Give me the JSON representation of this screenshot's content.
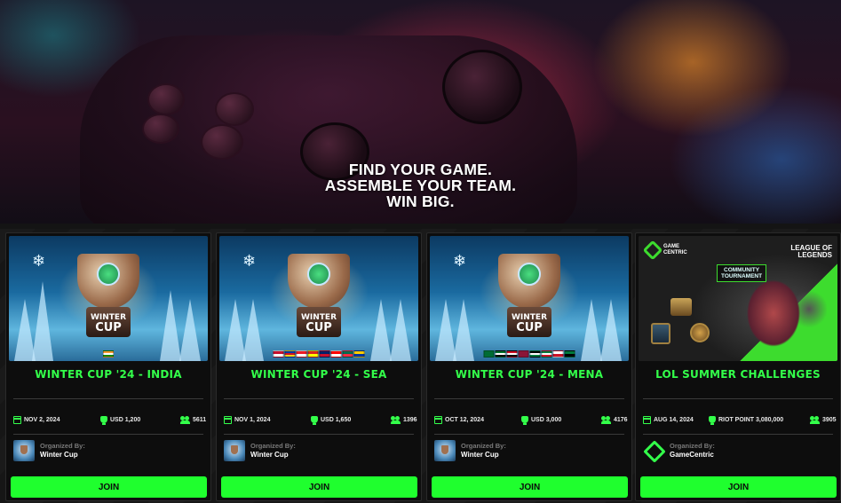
{
  "hero": {
    "line1": "FIND YOUR GAME.",
    "line2": "ASSEMBLE YOUR TEAM.",
    "line3": "WIN BIG."
  },
  "cards": [
    {
      "title": "WINTER CUP '24 - INDIA",
      "date": "NOV 2, 2024",
      "prize": "USD 1,200",
      "participants": "5611",
      "organizer_label": "Organized By:",
      "organizer": "Winter Cup",
      "join_label": "JOIN",
      "image": {
        "trophy_top": "WINTER",
        "trophy_bottom": "CUP"
      }
    },
    {
      "title": "WINTER CUP '24 - SEA",
      "date": "NOV 1, 2024",
      "prize": "USD 1,650",
      "participants": "1396",
      "organizer_label": "Organized By:",
      "organizer": "Winter Cup",
      "join_label": "JOIN",
      "image": {
        "trophy_top": "WINTER",
        "trophy_bottom": "CUP"
      }
    },
    {
      "title": "WINTER CUP '24 - MENA",
      "date": "OCT 12, 2024",
      "prize": "USD 3,000",
      "participants": "4176",
      "organizer_label": "Organized By:",
      "organizer": "Winter Cup",
      "join_label": "JOIN",
      "image": {
        "trophy_top": "WINTER",
        "trophy_bottom": "CUP"
      }
    },
    {
      "title": "LOL SUMMER CHALLENGES",
      "date": "AUG 14, 2024",
      "prize": "RIOT POINT 3,080,000",
      "participants": "3905",
      "organizer_label": "Organized By:",
      "organizer": "GameCentric",
      "join_label": "JOIN",
      "image": {
        "logo_line1": "GAME",
        "logo_line2": "CENTRIC",
        "brand_line1": "LEAGUE OF",
        "brand_line2": "LEGENDS",
        "badge_line1": "COMMUNITY",
        "badge_line2": "TOURNAMENT"
      }
    }
  ],
  "colors": {
    "accent": "#1fff2e",
    "title_green": "#33ff4a",
    "card_bg": "#0d0d0d"
  },
  "icons": [
    "calendar-icon",
    "trophy-icon",
    "users-icon",
    "snowflake-icon"
  ]
}
